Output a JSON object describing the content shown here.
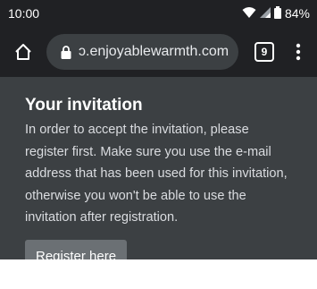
{
  "status": {
    "time": "10:00",
    "battery": "84%",
    "icons": [
      "wifi-icon",
      "signal-icon",
      "battery-icon"
    ]
  },
  "browser": {
    "url": "ɔ.enjoyablewarmth.com",
    "tab_count": "9",
    "icons": [
      "home-icon",
      "lock-icon",
      "tabs-icon",
      "more-vert-icon"
    ]
  },
  "page": {
    "title": "Your invitation",
    "message": "In order to accept the invitation, please register first. Make sure you use the e-mail address that has been used for this invitation, otherwise you won't be able to use the invitation after registration.",
    "register_label": "Register here"
  },
  "colors": {
    "chrome_bar": "#202124",
    "url_field": "#3c4043",
    "content_bg": "#3c4043",
    "button_bg": "#6b7074"
  }
}
